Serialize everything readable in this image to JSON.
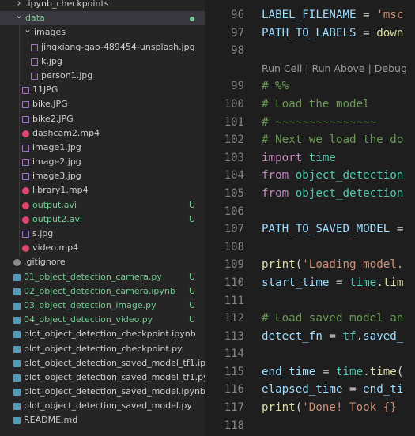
{
  "explorer": {
    "rows": [
      {
        "label": ".ipynb_checkpoints",
        "twisty": "closed",
        "indent": 0,
        "icon": "folder-icon",
        "color": "#cccccc"
      },
      {
        "label": "data",
        "twisty": "open",
        "indent": 0,
        "icon": "folder-icon",
        "color": "#73c991",
        "git": "dot",
        "selected": true
      },
      {
        "label": "images",
        "twisty": "open",
        "indent": 1,
        "icon": "folder-icon",
        "color": "#cccccc"
      },
      {
        "label": "jingxiang-gao-489454-unsplash.jpg",
        "indent": 2,
        "icon": "image-file-icon",
        "color": "#cccccc"
      },
      {
        "label": "k.jpg",
        "indent": 2,
        "icon": "image-file-icon",
        "color": "#cccccc"
      },
      {
        "label": "person1.jpg",
        "indent": 2,
        "icon": "image-file-icon",
        "color": "#cccccc"
      },
      {
        "label": "11JPG",
        "indent": 1,
        "icon": "image-file-icon",
        "color": "#cccccc"
      },
      {
        "label": "bike.JPG",
        "indent": 1,
        "icon": "image-file-icon",
        "color": "#cccccc"
      },
      {
        "label": "bike2.JPG",
        "indent": 1,
        "icon": "image-file-icon",
        "color": "#cccccc"
      },
      {
        "label": "dashcam2.mp4",
        "indent": 1,
        "icon": "video-file-icon",
        "color": "#cccccc"
      },
      {
        "label": "image1.jpg",
        "indent": 1,
        "icon": "image-file-icon",
        "color": "#cccccc"
      },
      {
        "label": "image2.jpg",
        "indent": 1,
        "icon": "image-file-icon",
        "color": "#cccccc"
      },
      {
        "label": "image3.jpg",
        "indent": 1,
        "icon": "image-file-icon",
        "color": "#cccccc"
      },
      {
        "label": "library1.mp4",
        "indent": 1,
        "icon": "video-file-icon",
        "color": "#cccccc"
      },
      {
        "label": "output.avi",
        "indent": 1,
        "icon": "video-file-icon",
        "color": "#73c991",
        "git": "U"
      },
      {
        "label": "output2.avi",
        "indent": 1,
        "icon": "video-file-icon",
        "color": "#73c991",
        "git": "U"
      },
      {
        "label": "s.jpg",
        "indent": 1,
        "icon": "image-file-icon",
        "color": "#cccccc"
      },
      {
        "label": "video.mp4",
        "indent": 1,
        "icon": "video-file-icon",
        "color": "#cccccc"
      },
      {
        "label": ".gitignore",
        "indent": 0,
        "icon": "git-file-icon",
        "color": "#cccccc"
      },
      {
        "label": "01_object_detection_camera.py",
        "indent": 0,
        "icon": "python-file-icon",
        "color": "#73c991",
        "git": "U"
      },
      {
        "label": "02_object_detection_camera.ipynb",
        "indent": 0,
        "icon": "notebook-file-icon",
        "color": "#73c991",
        "git": "U"
      },
      {
        "label": "03_object_detection_image.py",
        "indent": 0,
        "icon": "python-file-icon",
        "color": "#73c991",
        "git": "U"
      },
      {
        "label": "04_object_detection_video.py",
        "indent": 0,
        "icon": "python-file-icon",
        "color": "#73c991",
        "git": "U"
      },
      {
        "label": "plot_object_detection_checkpoint.ipynb",
        "indent": 0,
        "icon": "notebook-file-icon",
        "color": "#cccccc"
      },
      {
        "label": "plot_object_detection_checkpoint.py",
        "indent": 0,
        "icon": "python-file-icon",
        "color": "#cccccc"
      },
      {
        "label": "plot_object_detection_saved_model_tf1.ipynb",
        "indent": 0,
        "icon": "notebook-file-icon",
        "color": "#cccccc"
      },
      {
        "label": "plot_object_detection_saved_model_tf1.py",
        "indent": 0,
        "icon": "python-file-icon",
        "color": "#cccccc"
      },
      {
        "label": "plot_object_detection_saved_model.ipynb",
        "indent": 0,
        "icon": "notebook-file-icon",
        "color": "#cccccc"
      },
      {
        "label": "plot_object_detection_saved_model.py",
        "indent": 0,
        "icon": "python-file-icon",
        "color": "#cccccc"
      },
      {
        "label": "README.md",
        "indent": 0,
        "icon": "markdown-file-icon",
        "color": "#cccccc"
      }
    ],
    "icon_colors": {
      "folder-icon": "",
      "image-file-icon": "#a074c4",
      "video-file-icon": "#e0466b",
      "git-file-icon": "#8d8d8d",
      "python-file-icon": "#519aba",
      "notebook-file-icon": "#519aba",
      "markdown-file-icon": "#519aba"
    }
  },
  "editor": {
    "codelens": "Run Cell | Run Above | Debug",
    "lines": [
      {
        "num": "96",
        "tokens": [
          [
            "LABEL_FILENAME",
            "var"
          ],
          [
            " = ",
            "op"
          ],
          [
            "'msc",
            "str"
          ]
        ]
      },
      {
        "num": "97",
        "tokens": [
          [
            "PATH_TO_LABELS",
            "var"
          ],
          [
            " = ",
            "op"
          ],
          [
            "down",
            "fn"
          ]
        ]
      },
      {
        "num": "98",
        "tokens": []
      },
      {
        "num": "",
        "codelens": true,
        "tokens": []
      },
      {
        "num": "99",
        "tokens": [
          [
            "# %%",
            "cm"
          ]
        ]
      },
      {
        "num": "100",
        "tokens": [
          [
            "# Load the model",
            "cm"
          ]
        ]
      },
      {
        "num": "101",
        "tokens": [
          [
            "# ~~~~~~~~~~~~~~~",
            "cm"
          ]
        ]
      },
      {
        "num": "102",
        "tokens": [
          [
            "# Next we load the do",
            "cm"
          ]
        ]
      },
      {
        "num": "103",
        "tokens": [
          [
            "import",
            "kw"
          ],
          [
            " ",
            "op"
          ],
          [
            "time",
            "mod"
          ]
        ]
      },
      {
        "num": "104",
        "tokens": [
          [
            "from",
            "kw"
          ],
          [
            " ",
            "op"
          ],
          [
            "object_detection",
            "mod"
          ]
        ]
      },
      {
        "num": "105",
        "tokens": [
          [
            "from",
            "kw"
          ],
          [
            " ",
            "op"
          ],
          [
            "object_detection",
            "mod"
          ]
        ]
      },
      {
        "num": "106",
        "tokens": []
      },
      {
        "num": "107",
        "tokens": [
          [
            "PATH_TO_SAVED_MODEL",
            "var"
          ],
          [
            " =",
            "op"
          ]
        ]
      },
      {
        "num": "108",
        "tokens": []
      },
      {
        "num": "109",
        "tokens": [
          [
            "print",
            "fn"
          ],
          [
            "(",
            "op"
          ],
          [
            "'Loading model.",
            "str"
          ]
        ]
      },
      {
        "num": "110",
        "tokens": [
          [
            "start_time",
            "var"
          ],
          [
            " = ",
            "op"
          ],
          [
            "time",
            "mod"
          ],
          [
            ".",
            "op"
          ],
          [
            "tim",
            "fn"
          ]
        ]
      },
      {
        "num": "111",
        "tokens": []
      },
      {
        "num": "112",
        "tokens": [
          [
            "# Load saved model an",
            "cm"
          ]
        ]
      },
      {
        "num": "113",
        "tokens": [
          [
            "detect_fn",
            "var"
          ],
          [
            " = ",
            "op"
          ],
          [
            "tf",
            "mod"
          ],
          [
            ".",
            "op"
          ],
          [
            "saved_",
            "var"
          ]
        ]
      },
      {
        "num": "114",
        "tokens": []
      },
      {
        "num": "115",
        "tokens": [
          [
            "end_time",
            "var"
          ],
          [
            " = ",
            "op"
          ],
          [
            "time",
            "mod"
          ],
          [
            ".",
            "op"
          ],
          [
            "time",
            "fn"
          ],
          [
            "(",
            "op"
          ]
        ]
      },
      {
        "num": "116",
        "tokens": [
          [
            "elapsed_time",
            "var"
          ],
          [
            " = ",
            "op"
          ],
          [
            "end_ti",
            "var"
          ]
        ]
      },
      {
        "num": "117",
        "tokens": [
          [
            "print",
            "fn"
          ],
          [
            "(",
            "op"
          ],
          [
            "'Done! Took {}",
            "str"
          ]
        ]
      },
      {
        "num": "118",
        "tokens": []
      }
    ]
  }
}
